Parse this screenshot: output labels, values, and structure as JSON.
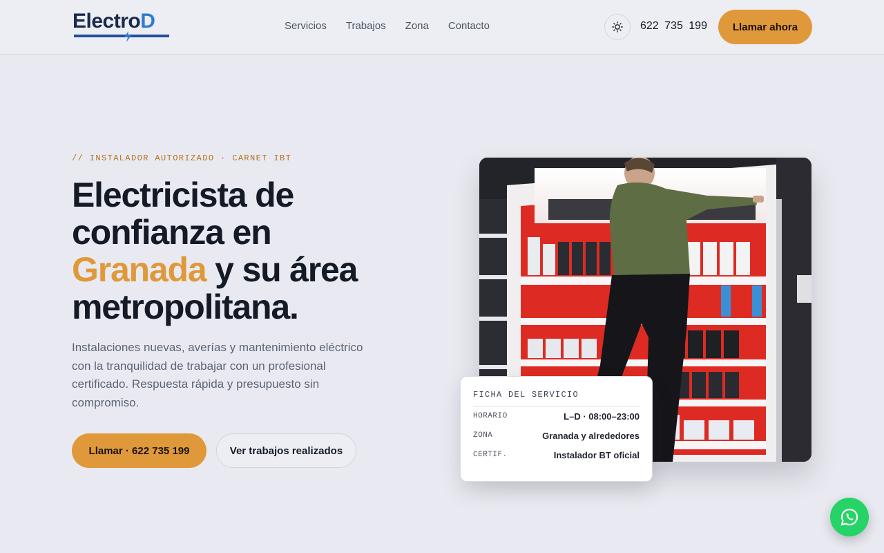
{
  "brand": {
    "name_main": "Electro",
    "name_accent": "D"
  },
  "nav": {
    "items": [
      "Servicios",
      "Trabajos",
      "Zona",
      "Contacto"
    ]
  },
  "header": {
    "phone": "622 735 199",
    "cta": "Llamar ahora"
  },
  "hero": {
    "eyebrow": "// INSTALADOR AUTORIZADO · CARNET IBT",
    "title_line1": "Electricista de confianza en",
    "title_accent": "Granada",
    "title_rest": "y su área metropolitana.",
    "description": "Instalaciones nuevas, averías y mantenimiento eléctrico con la tranquilidad de trabajar con un profesional certificado. Respuesta rápida y presupuesto sin compromiso.",
    "primary_button": "Llamar · 622 735 199",
    "secondary_button": "Ver trabajos realizados"
  },
  "service_card": {
    "title": "FICHA DEL SERVICIO",
    "rows": [
      {
        "key": "HORARIO",
        "value": "L–D · 08:00–23:00"
      },
      {
        "key": "ZONA",
        "value": "Granada y alrededores"
      },
      {
        "key": "CERTIF.",
        "value": "Instalador BT oficial"
      }
    ]
  },
  "colors": {
    "accent": "#e0993a",
    "background": "#e9eaf1",
    "whatsapp": "#25d366"
  }
}
